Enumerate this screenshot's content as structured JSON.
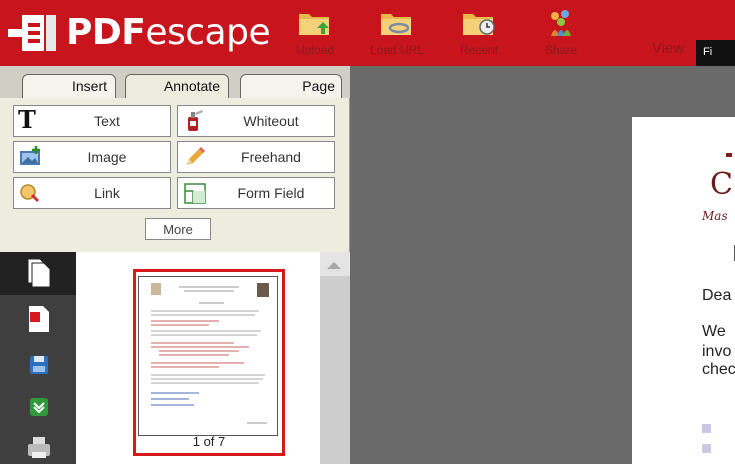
{
  "header": {
    "logo_text_bold": "PDF",
    "logo_text_thin": "escape",
    "tools": [
      {
        "name": "upload",
        "label": "Upload",
        "icon": "folder-upload-icon"
      },
      {
        "name": "load-url",
        "label": "Load URL",
        "icon": "folder-link-icon"
      },
      {
        "name": "recent",
        "label": "Recent",
        "icon": "folder-clock-icon"
      },
      {
        "name": "share",
        "label": "Share",
        "icon": "people-icon"
      }
    ],
    "view_label": "View",
    "fit_label": "Fi"
  },
  "tabs": [
    "Insert",
    "Annotate",
    "Page"
  ],
  "insert_tools": [
    {
      "label": "Text",
      "icon": "text-icon"
    },
    {
      "label": "Whiteout",
      "icon": "whiteout-icon"
    },
    {
      "label": "Image",
      "icon": "image-icon"
    },
    {
      "label": "Freehand",
      "icon": "pencil-icon"
    },
    {
      "label": "Link",
      "icon": "link-icon"
    },
    {
      "label": "Form Field",
      "icon": "form-field-icon"
    }
  ],
  "more_label": "More",
  "sidebar": [
    "pages-icon",
    "pdf-icon",
    "save-icon",
    "download-icon",
    "print-icon"
  ],
  "thumbnail": {
    "page_label": "1 of 7"
  },
  "document": {
    "lines": [
      "Dea",
      "We",
      "invo",
      "chec"
    ],
    "crest_letter": "C",
    "crest_sub": "Mas"
  },
  "colors": {
    "brand": "#c7141d",
    "thumb_border": "#d7191e"
  }
}
